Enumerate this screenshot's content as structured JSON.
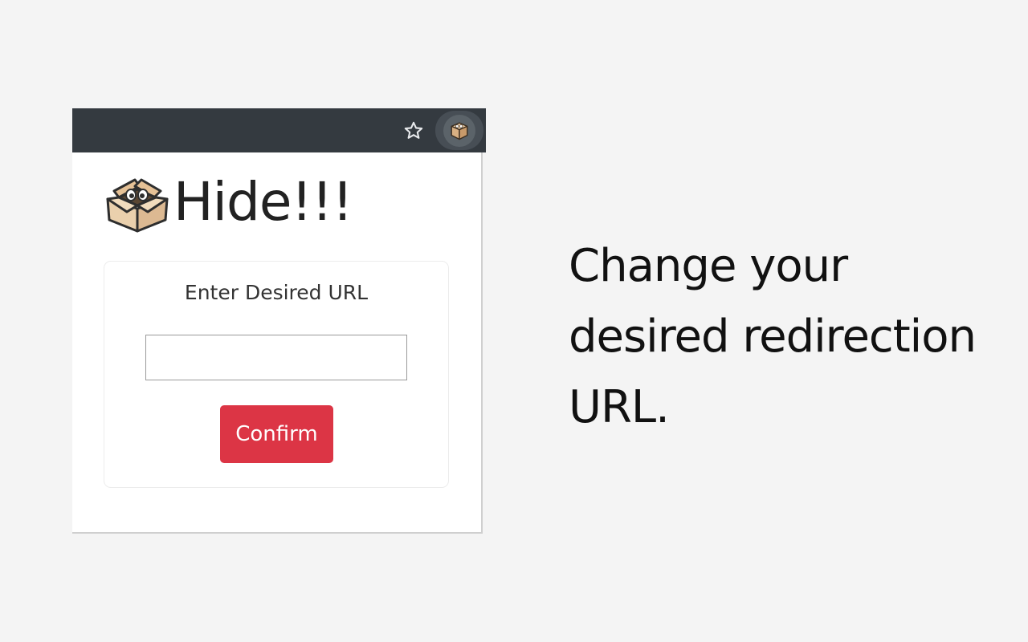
{
  "toolbar": {
    "bookmark_icon": "star-outline-icon",
    "extension_icon": "cardboard-box-icon"
  },
  "popup": {
    "brand_title": "Hide!!!",
    "logo_icon": "cardboard-box-with-eyes-icon",
    "form": {
      "label": "Enter Desired URL",
      "url_value": "",
      "url_placeholder": "",
      "confirm_label": "Confirm"
    }
  },
  "caption": {
    "text": "Change your desired redirection URL."
  },
  "colors": {
    "toolbar_bg": "#343a40",
    "confirm_bg": "#dc3545",
    "page_bg": "#f4f4f4"
  }
}
